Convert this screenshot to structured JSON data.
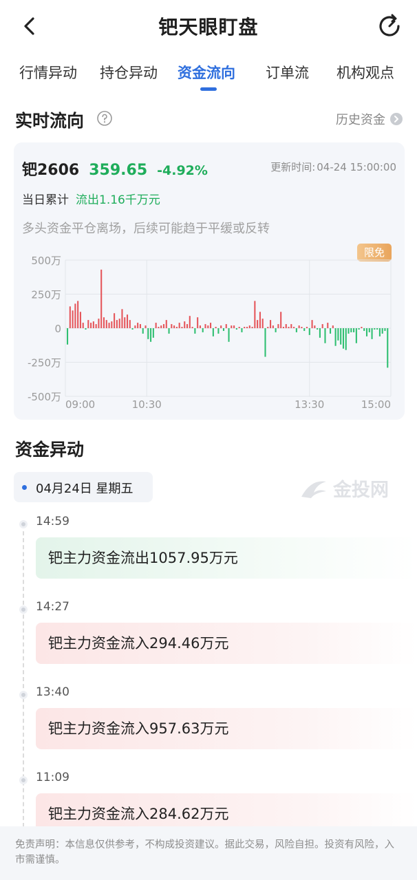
{
  "header": {
    "title": "钯天眼盯盘",
    "back_icon": "chevron-left-icon",
    "refresh_icon": "refresh-icon"
  },
  "tabs": [
    {
      "label": "行情异动",
      "active": false
    },
    {
      "label": "持仓异动",
      "active": false
    },
    {
      "label": "资金流向",
      "active": true
    },
    {
      "label": "订单流",
      "active": false
    },
    {
      "label": "机构观点",
      "active": false
    }
  ],
  "realtime": {
    "title": "实时流向",
    "history_label": "历史资金",
    "contract": "钯2606",
    "price": "359.65",
    "change": "-4.92%",
    "update_label": "更新时间:",
    "update_time": "04-24 15:00:00",
    "cum_label": "当日累计",
    "cum_value": "流出1.16千万元",
    "hint": "多头资金平仓离场，后续可能趋于平缓或反转",
    "badge": "限免"
  },
  "colors": {
    "inflow": "#e5555a",
    "outflow": "#2fbf71",
    "accent": "#2f6fde"
  },
  "chart_data": {
    "type": "bar",
    "ylim": [
      -500,
      500
    ],
    "y_ticks": [
      "500万",
      "250万",
      "0",
      "-250万",
      "-500万"
    ],
    "y_tick_values": [
      500,
      250,
      0,
      -250,
      -500
    ],
    "x_ticks": [
      "09:00",
      "10:30",
      "13:30",
      "15:00"
    ],
    "unit": "万",
    "values": [
      -120,
      160,
      130,
      180,
      200,
      120,
      40,
      -10,
      60,
      40,
      50,
      30,
      70,
      430,
      80,
      60,
      40,
      50,
      110,
      60,
      70,
      140,
      80,
      100,
      60,
      -10,
      20,
      40,
      30,
      -40,
      20,
      -80,
      -100,
      -70,
      40,
      10,
      20,
      30,
      60,
      -40,
      30,
      20,
      10,
      40,
      10,
      50,
      30,
      90,
      10,
      -40,
      80,
      20,
      -30,
      30,
      20,
      40,
      -60,
      10,
      -40,
      20,
      -20,
      30,
      -100,
      20,
      20,
      -10,
      10,
      -30,
      10,
      10,
      20,
      10,
      200,
      60,
      120,
      70,
      -210,
      10,
      60,
      20,
      -30,
      30,
      120,
      10,
      30,
      10,
      30,
      10,
      -30,
      20,
      10,
      -20,
      10,
      -50,
      60,
      20,
      -10,
      -70,
      30,
      -110,
      40,
      -40,
      20,
      -130,
      -90,
      -120,
      -150,
      -160,
      -40,
      -30,
      -30,
      -110,
      -10,
      10,
      -20,
      -60,
      -30,
      -80,
      -10,
      -10,
      -60,
      -40,
      -20,
      -290
    ]
  },
  "anomaly": {
    "title": "资金异动",
    "date": "04月24日 星期五",
    "watermark": "金投网",
    "events": [
      {
        "time": "14:59",
        "text": "钯主力资金流出1057.95万元",
        "direction": "out"
      },
      {
        "time": "14:27",
        "text": "钯主力资金流入294.46万元",
        "direction": "in"
      },
      {
        "time": "13:40",
        "text": "钯主力资金流入957.63万元",
        "direction": "in"
      },
      {
        "time": "11:09",
        "text": "钯主力资金流入284.62万元",
        "direction": "in"
      }
    ]
  },
  "disclaimer": "免责声明：本信息仅供参考，不构成投资建议。据此交易，风险自担。投资有风险，入市需谨慎。"
}
